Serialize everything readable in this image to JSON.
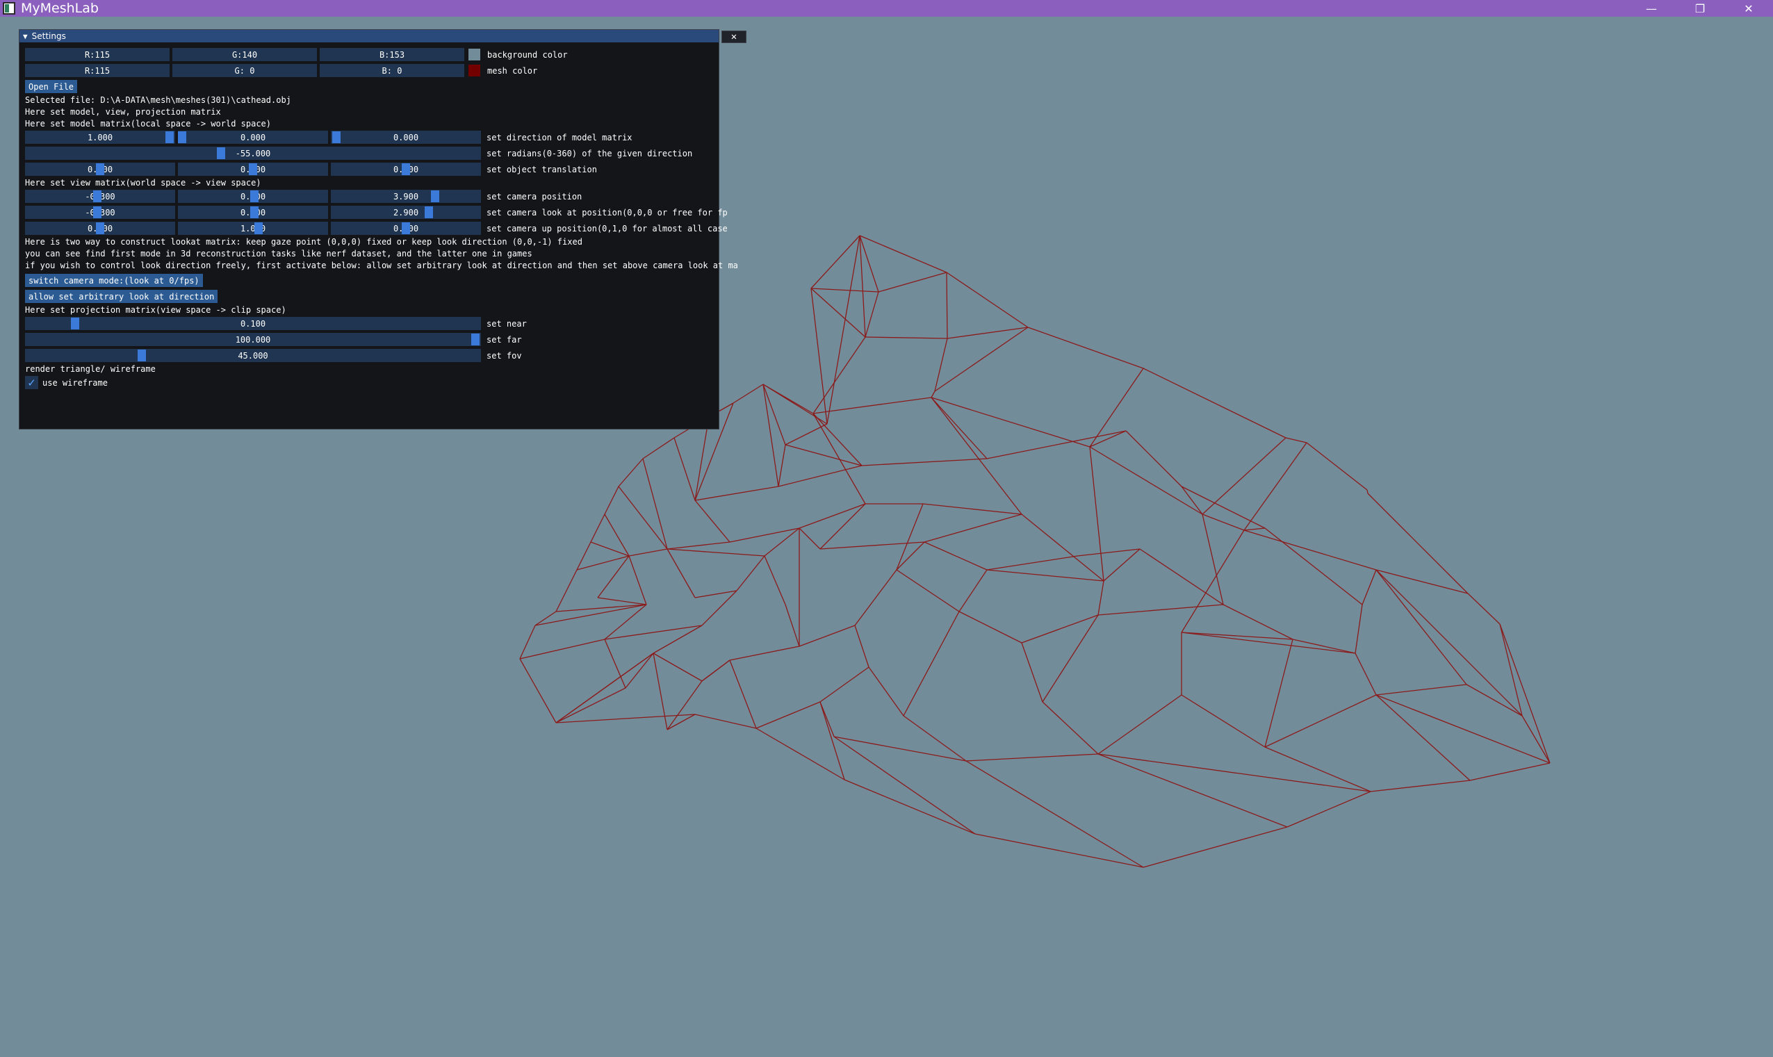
{
  "window": {
    "title": "MyMeshLab",
    "controls": {
      "minimize": "—",
      "restore": "❐",
      "close": "✕"
    }
  },
  "colors": {
    "background": "#738c99",
    "mesh": "#730000",
    "titlebar": "#8a5fbe",
    "panel": "#141518",
    "field": "#1f3552",
    "button": "#2b5b92",
    "slider_grab": "#3b7ad8"
  },
  "panel": {
    "title": "Settings",
    "collapse_icon": "▼",
    "close_icon": "✕",
    "background_color": {
      "r": "R:115",
      "g": "G:140",
      "b": "B:153",
      "label": "background color"
    },
    "mesh_color": {
      "r": "R:115",
      "g": "G:  0",
      "b": "B:  0",
      "label": "mesh color"
    },
    "open_file_label": "Open File",
    "selected_file": "Selected file: D:\\A-DATA\\mesh\\meshes(301)\\cathead.obj",
    "intro": "Here set model, view, projection matrix",
    "model_header": "Here set model matrix(local space -> world space)",
    "model_direction": {
      "x": "1.000",
      "y": "0.000",
      "z": "0.000",
      "label": "set direction of model matrix"
    },
    "model_radians": {
      "value": "-55.000",
      "label": "set radians(0-360) of the given direction"
    },
    "model_translation": {
      "x": "0.000",
      "y": "0.000",
      "z": "0.000",
      "label": "set object translation"
    },
    "view_header": "Here set view matrix(world space -> view space)",
    "camera_position": {
      "x": "-0.300",
      "y": "0.800",
      "z": "3.900",
      "label": "set camera position"
    },
    "camera_look": {
      "x": "-0.300",
      "y": "0.800",
      "z": "2.900",
      "label": "set camera look at position(0,0,0 or free for fp"
    },
    "camera_up": {
      "x": "0.000",
      "y": "1.000",
      "z": "0.000",
      "label": "set camera up position(0,1,0 for almost all case"
    },
    "info_line1": "Here is two way to construct lookat matrix: keep gaze point (0,0,0) fixed or keep look direction (0,0,-1) fixed",
    "info_line2": "you can see find first mode in 3d reconstruction tasks like nerf dataset, and the latter one in games",
    "info_line3": "if you wish to control look direction freely, first activate below: allow set arbitrary look at direction and then set above camera look at ma",
    "switch_camera_label": "switch camera mode:(look at 0/fps)",
    "allow_arbitrary_label": "allow set arbitrary look at direction",
    "projection_header": "Here set projection matrix(view space -> clip space)",
    "near": {
      "value": "0.100",
      "label": "set near"
    },
    "far": {
      "value": "100.000",
      "label": "set far"
    },
    "fov": {
      "value": "45.000",
      "label": "set fov"
    },
    "render_header": "render triangle/ wireframe",
    "wireframe": {
      "checked": true,
      "label": "use wireframe"
    }
  }
}
